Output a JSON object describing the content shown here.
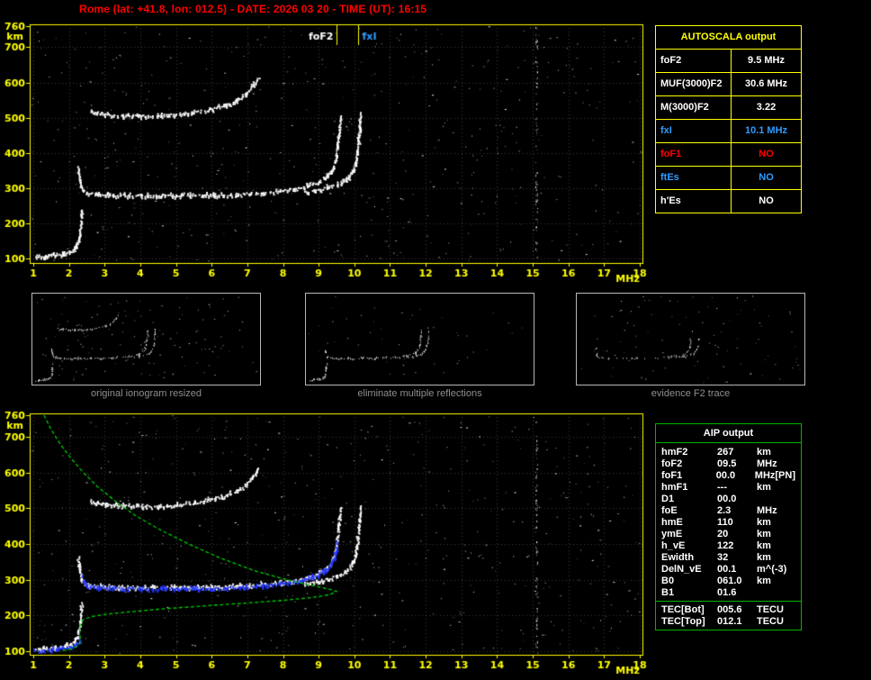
{
  "palette": {
    "yellow": "#ffff00",
    "green": "#00b400",
    "red": "#ff0000",
    "blue": "#2e9bff",
    "trace_white": "#ffffff",
    "trace_blue": "#2336ff",
    "profile_green": "#00cc00",
    "caption_gray": "#8f8f8f"
  },
  "header": {
    "title": "Rome (lat: +41.8, lon: 012.5) - DATE: 2026 03 20 - TIME (UT): 16:15"
  },
  "autoscala": {
    "title": "AUTOSCALA output",
    "rows": [
      {
        "label": "foF2",
        "value": "9.5 MHz",
        "color": "#ffffff"
      },
      {
        "label": "MUF(3000)F2",
        "value": "30.6 MHz",
        "color": "#ffffff"
      },
      {
        "label": "M(3000)F2",
        "value": "3.22",
        "color": "#ffffff"
      },
      {
        "label": "fxI",
        "value": "10.1 MHz",
        "color": "#2e9bff"
      },
      {
        "label": "foF1",
        "value": "NO",
        "color": "#ff0000"
      },
      {
        "label": "ftEs",
        "value": "NO",
        "color": "#2e9bff"
      },
      {
        "label": "h'Es",
        "value": "NO",
        "color": "#ffffff"
      }
    ]
  },
  "aip": {
    "title": "AIP output",
    "rows": [
      {
        "name": "hmF2",
        "value": "267",
        "unit": "km"
      },
      {
        "name": "foF2",
        "value": "09.5",
        "unit": "MHz"
      },
      {
        "name": "foF1",
        "value": "00.0",
        "unit": "MHz",
        "tag": "[PN]"
      },
      {
        "name": "hmF1",
        "value": "---",
        "unit": "km"
      },
      {
        "name": "D1",
        "value": "00.0",
        "unit": ""
      },
      {
        "name": "foE",
        "value": "2.3",
        "unit": "MHz"
      },
      {
        "name": "hmE",
        "value": "110",
        "unit": "km"
      },
      {
        "name": "ymE",
        "value": "20",
        "unit": "km"
      },
      {
        "name": "h_vE",
        "value": "122",
        "unit": "km"
      },
      {
        "name": "Ewidth",
        "value": "32",
        "unit": "km"
      },
      {
        "name": "DelN_vE",
        "value": "00.1",
        "unit": "m^(-3)"
      },
      {
        "name": "B0",
        "value": "061.0",
        "unit": "km"
      },
      {
        "name": "B1",
        "value": "01.6",
        "unit": ""
      }
    ],
    "tec_rows": [
      {
        "name": "TEC[Bot]",
        "value": "005.6",
        "unit": "TECU"
      },
      {
        "name": "TEC[Top]",
        "value": "012.1",
        "unit": "TECU"
      }
    ]
  },
  "thumbnails": [
    {
      "caption": "original ionogram resized",
      "series": [
        "e_region_echo",
        "f2_ordinary_echo",
        "f2_extraordinary_echo",
        "second_hop_echo"
      ],
      "noise_dots": 130,
      "trace_density": 0.8,
      "seed": 21
    },
    {
      "caption": "eliminate multiple reflections",
      "series": [
        "e_region_echo",
        "f2_ordinary_echo",
        "f2_extraordinary_echo"
      ],
      "noise_dots": 45,
      "trace_density": 0.8,
      "seed": 22
    },
    {
      "caption": "evidence F2 trace",
      "series": [
        "f2_ordinary_echo",
        "f2_extraordinary_echo"
      ],
      "noise_dots": 95,
      "trace_density": 0.45,
      "seed": 23
    }
  ],
  "traces": {
    "e_region_echo": {
      "color": "#ffffff",
      "style": "echo",
      "points": [
        [
          1.05,
          106
        ],
        [
          1.3,
          108
        ],
        [
          1.6,
          111
        ],
        [
          1.85,
          115
        ],
        [
          2.0,
          120
        ],
        [
          2.12,
          128
        ],
        [
          2.2,
          140
        ],
        [
          2.26,
          158
        ],
        [
          2.3,
          180
        ],
        [
          2.32,
          205
        ],
        [
          2.34,
          235
        ]
      ]
    },
    "f2_ordinary_echo": {
      "color": "#ffffff",
      "style": "echo",
      "points": [
        [
          2.25,
          360
        ],
        [
          2.28,
          335
        ],
        [
          2.32,
          310
        ],
        [
          2.38,
          295
        ],
        [
          2.5,
          287
        ],
        [
          2.8,
          283
        ],
        [
          3.2,
          281
        ],
        [
          4.0,
          280
        ],
        [
          5.0,
          280
        ],
        [
          6.0,
          281
        ],
        [
          6.8,
          284
        ],
        [
          7.4,
          288
        ],
        [
          7.9,
          293
        ],
        [
          8.3,
          299
        ],
        [
          8.7,
          308
        ],
        [
          9.0,
          319
        ],
        [
          9.2,
          332
        ],
        [
          9.33,
          347
        ],
        [
          9.42,
          366
        ],
        [
          9.48,
          392
        ],
        [
          9.52,
          424
        ],
        [
          9.56,
          462
        ],
        [
          9.6,
          505
        ]
      ]
    },
    "f2_extraordinary_echo": {
      "color": "#ffffff",
      "style": "echo",
      "points": [
        [
          8.6,
          291
        ],
        [
          8.9,
          296
        ],
        [
          9.2,
          302
        ],
        [
          9.5,
          311
        ],
        [
          9.7,
          321
        ],
        [
          9.85,
          334
        ],
        [
          9.95,
          351
        ],
        [
          10.02,
          372
        ],
        [
          10.07,
          400
        ],
        [
          10.1,
          434
        ],
        [
          10.13,
          473
        ],
        [
          10.15,
          508
        ]
      ]
    },
    "second_hop_echo": {
      "color": "#ffffff",
      "style": "echo",
      "points": [
        [
          2.6,
          518
        ],
        [
          3.0,
          512
        ],
        [
          3.5,
          508
        ],
        [
          4.0,
          506
        ],
        [
          4.5,
          507
        ],
        [
          5.0,
          510
        ],
        [
          5.5,
          516
        ],
        [
          6.0,
          526
        ],
        [
          6.4,
          538
        ],
        [
          6.7,
          552
        ],
        [
          6.95,
          570
        ],
        [
          7.15,
          592
        ],
        [
          7.3,
          615
        ]
      ]
    },
    "restored_f2_blue": {
      "color": "#2336ff",
      "style": "echo",
      "points": [
        [
          2.35,
          310
        ],
        [
          2.4,
          296
        ],
        [
          2.5,
          286
        ],
        [
          2.8,
          280
        ],
        [
          3.2,
          277
        ],
        [
          4.0,
          276
        ],
        [
          5.0,
          276
        ],
        [
          6.0,
          277
        ],
        [
          6.8,
          280
        ],
        [
          7.4,
          285
        ],
        [
          7.9,
          290
        ],
        [
          8.3,
          296
        ],
        [
          8.7,
          305
        ],
        [
          9.0,
          316
        ],
        [
          9.2,
          330
        ],
        [
          9.33,
          345
        ],
        [
          9.42,
          363
        ],
        [
          9.48,
          388
        ],
        [
          9.5,
          405
        ]
      ]
    },
    "restored_e_blue": {
      "color": "#2336ff",
      "style": "echo",
      "points": [
        [
          1.0,
          104
        ],
        [
          1.4,
          106
        ],
        [
          1.8,
          109
        ],
        [
          2.05,
          112
        ],
        [
          2.2,
          118
        ],
        [
          2.3,
          128
        ]
      ]
    },
    "electron_density_profile": {
      "color": "#00cc00",
      "style": "line",
      "points": [
        [
          1.3,
          760
        ],
        [
          1.5,
          720
        ],
        [
          1.75,
          680
        ],
        [
          2.05,
          640
        ],
        [
          2.4,
          600
        ],
        [
          2.8,
          560
        ],
        [
          3.3,
          520
        ],
        [
          3.85,
          480
        ],
        [
          4.55,
          440
        ],
        [
          5.35,
          400
        ],
        [
          6.25,
          360
        ],
        [
          7.2,
          325
        ],
        [
          8.1,
          300
        ],
        [
          8.85,
          283
        ],
        [
          9.35,
          272
        ],
        [
          9.5,
          267
        ],
        [
          9.3,
          258
        ],
        [
          8.8,
          250
        ],
        [
          8.0,
          242
        ],
        [
          6.9,
          234
        ],
        [
          5.7,
          226
        ],
        [
          4.6,
          218
        ],
        [
          3.7,
          210
        ],
        [
          3.0,
          203
        ],
        [
          2.6,
          196
        ],
        [
          2.4,
          188
        ],
        [
          2.32,
          178
        ],
        [
          2.3,
          165
        ],
        [
          2.3,
          150
        ],
        [
          2.32,
          135
        ],
        [
          2.3,
          122
        ],
        [
          2.2,
          112
        ],
        [
          2.0,
          105
        ],
        [
          1.75,
          100
        ]
      ]
    }
  },
  "chart_data": [
    {
      "id": "top_ionogram",
      "type": "scatter",
      "title": "scaled ionogram with foF2 / fxI markers",
      "xlabel": "MHz",
      "ylabel": "km",
      "xlim": [
        1,
        18
      ],
      "ylim": [
        100,
        760
      ],
      "x_ticks": [
        1,
        2,
        3,
        4,
        5,
        6,
        7,
        8,
        9,
        10,
        11,
        12,
        13,
        14,
        15,
        16,
        17,
        18
      ],
      "y_ticks": [
        760,
        700,
        600,
        500,
        400,
        300,
        200,
        100
      ],
      "grid": true,
      "legend": "none",
      "noise_dots": 520,
      "rfi_band_mhz": 15.1,
      "seed": 7,
      "markers": [
        {
          "label": "foF2",
          "mhz": 9.5,
          "color": "#ffffff",
          "side": "left"
        },
        {
          "label": "fxI",
          "mhz": 10.1,
          "color": "#2e9bff",
          "side": "right"
        }
      ],
      "series": [
        "e_region_echo",
        "f2_ordinary_echo",
        "f2_extraordinary_echo",
        "second_hop_echo"
      ]
    },
    {
      "id": "bottom_ionogram_with_profile",
      "type": "scatter",
      "title": "ionogram with restored trace and electron density profile",
      "xlabel": "MHz",
      "ylabel": "km",
      "xlim": [
        1,
        18
      ],
      "ylim": [
        100,
        760
      ],
      "x_ticks": [
        1,
        2,
        3,
        4,
        5,
        6,
        7,
        8,
        9,
        10,
        11,
        12,
        13,
        14,
        15,
        16,
        17,
        18
      ],
      "y_ticks": [
        760,
        700,
        600,
        500,
        400,
        300,
        200,
        100
      ],
      "grid": true,
      "legend": "none",
      "noise_dots": 520,
      "rfi_band_mhz": 15.1,
      "seed": 11,
      "markers": [],
      "series": [
        "e_region_echo",
        "f2_ordinary_echo",
        "f2_extraordinary_echo",
        "second_hop_echo",
        "restored_f2_blue",
        "restored_e_blue",
        "electron_density_profile"
      ]
    }
  ]
}
